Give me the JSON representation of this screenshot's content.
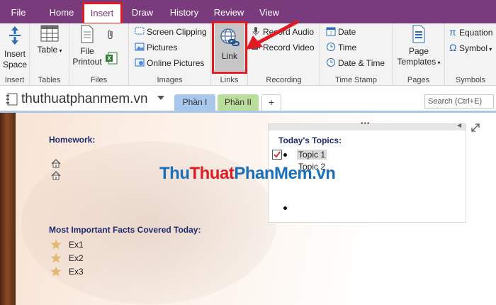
{
  "menu": {
    "tabs": [
      {
        "label": "File"
      },
      {
        "label": "Home"
      },
      {
        "label": "Insert",
        "active": true
      },
      {
        "label": "Draw"
      },
      {
        "label": "History"
      },
      {
        "label": "Review"
      },
      {
        "label": "View"
      }
    ]
  },
  "ribbon": {
    "insert_space": "Insert Space",
    "insert_group": "Insert",
    "table": "Table",
    "tables_group": "Tables",
    "file_printout": "File Printout",
    "files_group": "Files",
    "screen_clipping": "Screen Clipping",
    "pictures": "Pictures",
    "online_pictures": "Online Pictures",
    "images_group": "Images",
    "link": "Link",
    "links_group": "Links",
    "record_audio": "Record Audio",
    "record_video": "Record Video",
    "recording_group": "Recording",
    "date": "Date",
    "time": "Time",
    "date_time": "Date & Time",
    "timestamp_group": "Time Stamp",
    "page_templates": "Page Templates",
    "pages_group": "Pages",
    "equation": "Equation",
    "symbol": "Symbol",
    "symbols_group": "Symbols"
  },
  "notebook": {
    "name": "thuthuatphanmem.vn",
    "sections": [
      {
        "label": "Phần I",
        "color": "#a8c7ec"
      },
      {
        "label": "Phần II",
        "color": "#b9de9b"
      }
    ],
    "add_section": "+",
    "search_placeholder": "Search (Ctrl+E)"
  },
  "page": {
    "homework_title": "Homework:",
    "facts_title": "Most Important Facts Covered Today:",
    "facts": [
      "Ex1",
      "Ex2",
      "Ex3"
    ],
    "topics_title": "Today's Topics:",
    "topics": [
      "Topic 1",
      "Topic 2"
    ],
    "watermark": {
      "part1": "Thu",
      "part2": "Thuat",
      "part3": "PhanMem",
      "part4": ".vn"
    }
  },
  "colors": {
    "accent": "#7a3b7d",
    "highlight": "#e01b24",
    "heading": "#1f2a6e"
  }
}
